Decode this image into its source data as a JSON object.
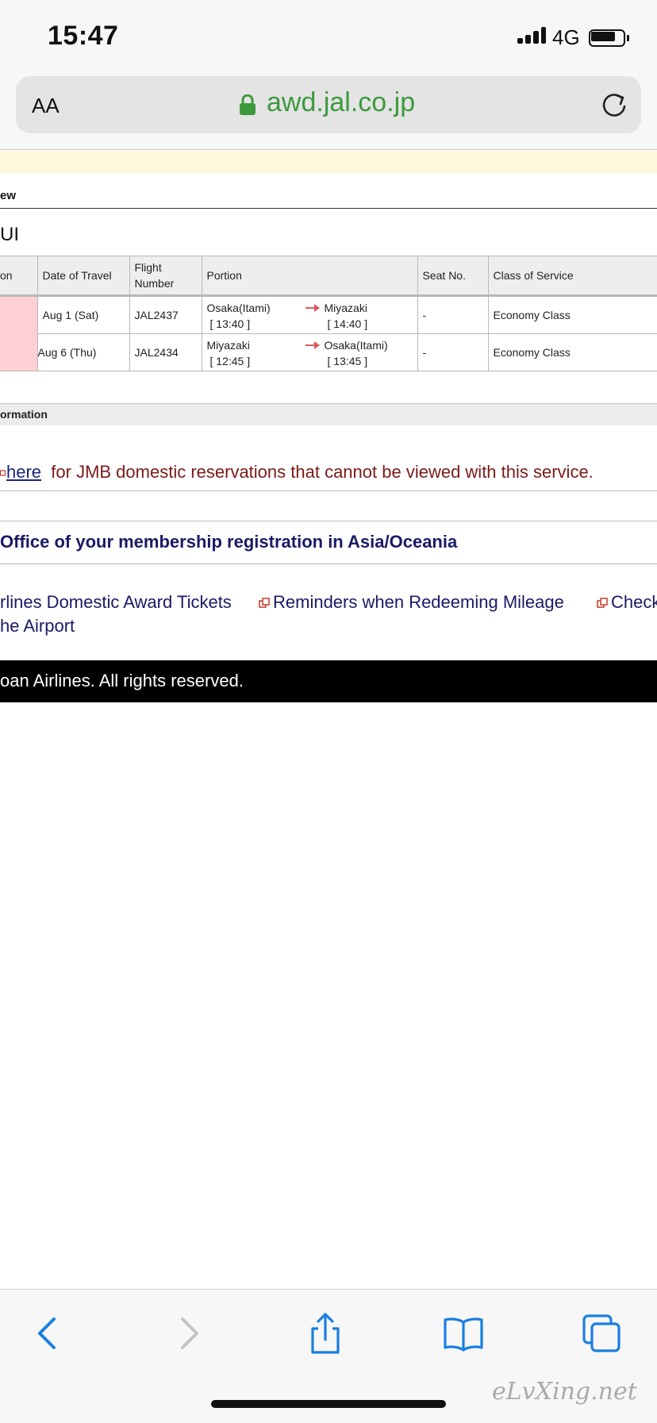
{
  "status_bar": {
    "time": "15:47",
    "network": "4G"
  },
  "address_bar": {
    "text_size_label": "AA",
    "url": "awd.jal.co.jp"
  },
  "page": {
    "section_label": "ew",
    "name_label": "UI",
    "table": {
      "headers": [
        "on",
        "Date of Travel",
        "Flight Number",
        "Portion",
        "Seat No.",
        "Class of Service"
      ],
      "rows": [
        {
          "date": "Aug 1 (Sat)",
          "flight": "JAL2437",
          "from": "Osaka(Itami)",
          "from_time": "[ 13:40 ]",
          "to": "Miyazaki",
          "to_time": "[ 14:40 ]",
          "seat": "-",
          "class": "Economy Class"
        },
        {
          "date": "Aug 6 (Thu)",
          "flight": "JAL2434",
          "from": "Miyazaki",
          "from_time": "[ 12:45 ]",
          "to": "Osaka(Itami)",
          "to_time": "[ 13:45 ]",
          "seat": "-",
          "class": "Economy Class"
        }
      ]
    },
    "info_label": "ormation",
    "jmb": {
      "link": "here",
      "text": "for JMB domestic reservations that cannot be viewed with this service."
    },
    "office_heading": "Office of your membership registration in Asia/Oceania",
    "links": [
      "rlines Domestic Award Tickets",
      "Reminders when Redeeming Mileage",
      "Check",
      "he Airport"
    ],
    "footer": "oan Airlines. All rights reserved."
  },
  "watermark": "eLvXing.net",
  "colors": {
    "accent_green": "#3c9a3c",
    "link_navy": "#1a1a66",
    "toolbar_blue": "#1a7fe0",
    "pink_cell": "#fdd0d3"
  }
}
